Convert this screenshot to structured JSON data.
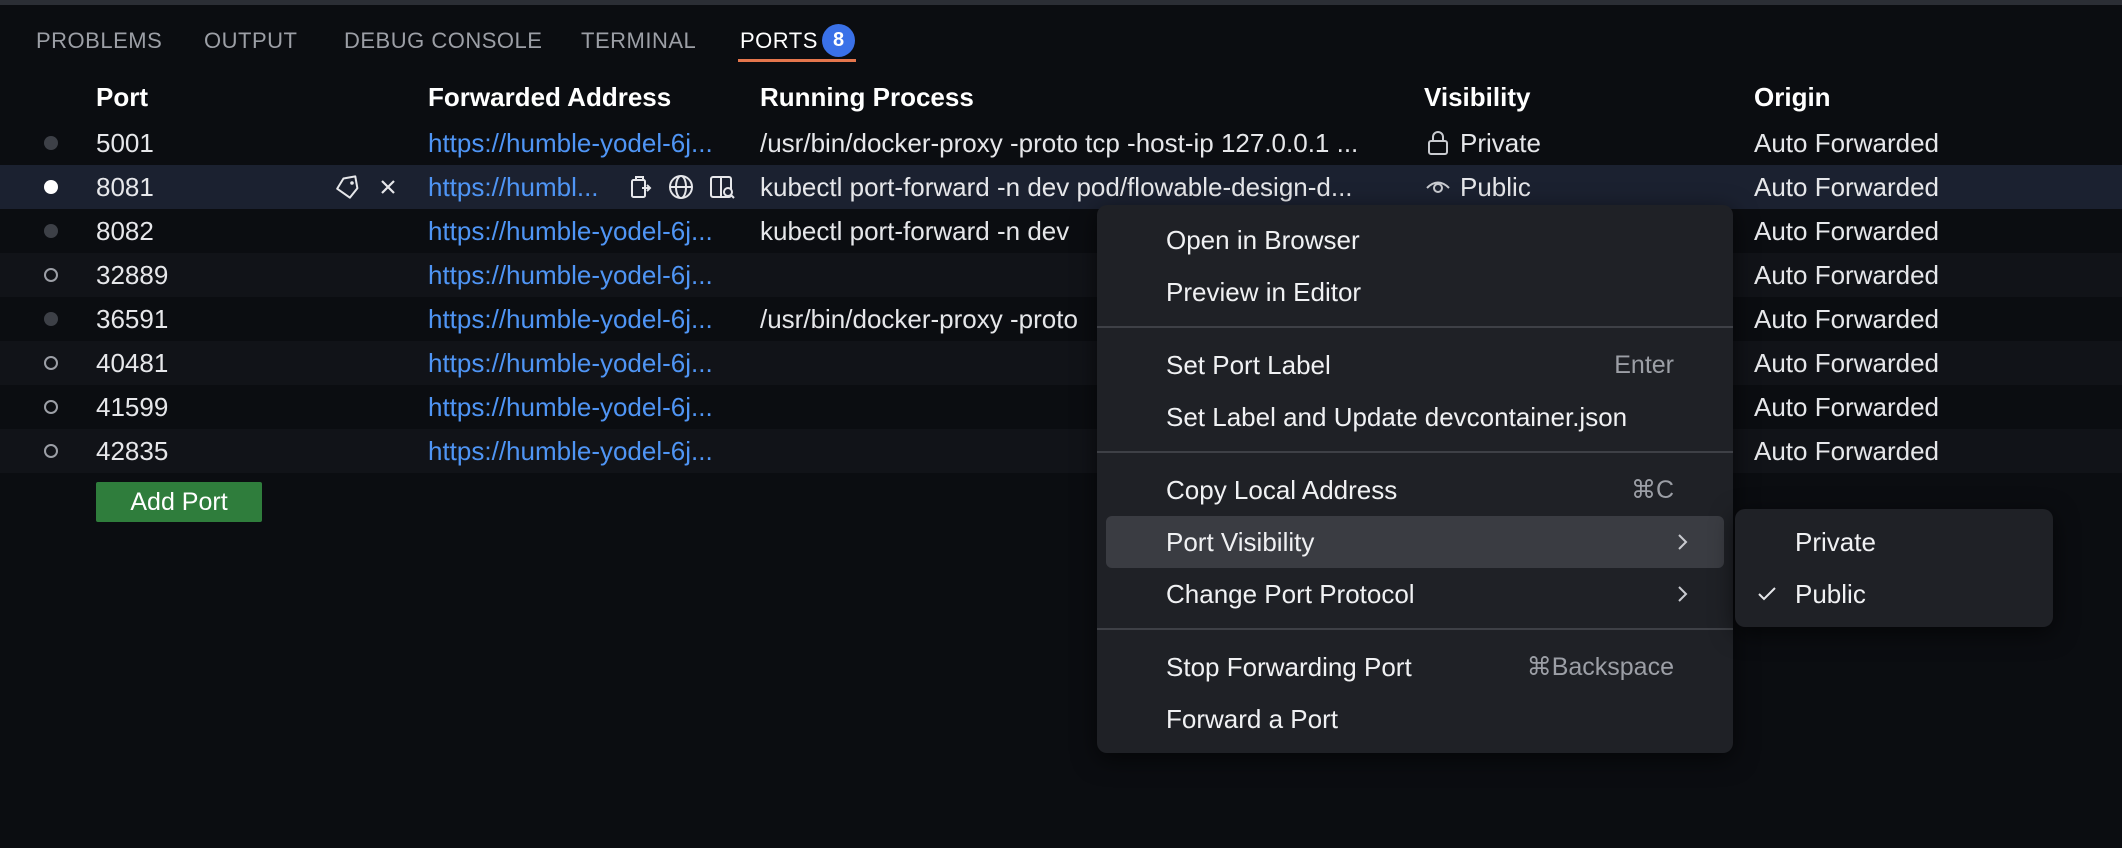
{
  "panel": {
    "tabs": [
      {
        "label": "PROBLEMS"
      },
      {
        "label": "OUTPUT"
      },
      {
        "label": "DEBUG CONSOLE"
      },
      {
        "label": "TERMINAL"
      },
      {
        "label": "PORTS",
        "badge": "8"
      }
    ],
    "active_tab": "PORTS"
  },
  "ports_table": {
    "columns": [
      "Port",
      "Forwarded Address",
      "Running Process",
      "Visibility",
      "Origin"
    ],
    "rows": [
      {
        "status": "inactive",
        "port": "5001",
        "address": "https://humble-yodel-6j...",
        "process": "/usr/bin/docker-proxy -proto tcp -host-ip 127.0.0.1 ...",
        "visibility": "Private",
        "visibility_icon": "lock-icon",
        "origin": "Auto Forwarded"
      },
      {
        "status": "selected",
        "port": "8081",
        "address": "https://humbl...",
        "process": "kubectl port-forward -n dev pod/flowable-design-d...",
        "visibility": "Public",
        "visibility_icon": "eye-icon",
        "origin": "Auto Forwarded"
      },
      {
        "status": "inactive",
        "port": "8082",
        "address": "https://humble-yodel-6j...",
        "process": "kubectl port-forward -n dev",
        "visibility": "",
        "origin": "Auto Forwarded"
      },
      {
        "status": "hollow",
        "port": "32889",
        "address": "https://humble-yodel-6j...",
        "process": "",
        "visibility": "",
        "origin": "Auto Forwarded"
      },
      {
        "status": "inactive",
        "port": "36591",
        "address": "https://humble-yodel-6j...",
        "process": "/usr/bin/docker-proxy -proto",
        "visibility": "",
        "origin": "Auto Forwarded"
      },
      {
        "status": "hollow",
        "port": "40481",
        "address": "https://humble-yodel-6j...",
        "process": "",
        "visibility": "",
        "origin": "Auto Forwarded"
      },
      {
        "status": "hollow",
        "port": "41599",
        "address": "https://humble-yodel-6j...",
        "process": "",
        "visibility": "",
        "origin": "Auto Forwarded"
      },
      {
        "status": "hollow",
        "port": "42835",
        "address": "https://humble-yodel-6j...",
        "process": "",
        "visibility": "",
        "origin": "Auto Forwarded"
      }
    ],
    "row_actions": [
      "tag-icon",
      "close-icon"
    ],
    "address_actions": [
      "copy-icon",
      "globe-icon",
      "preview-icon"
    ],
    "add_port_label": "Add Port"
  },
  "context_menu": {
    "items": [
      {
        "label": "Open in Browser",
        "shortcut": ""
      },
      {
        "label": "Preview in Editor",
        "shortcut": ""
      },
      {
        "label": "Set Port Label",
        "shortcut": "Enter"
      },
      {
        "label": "Set Label and Update devcontainer.json",
        "shortcut": ""
      },
      {
        "label": "Copy Local Address",
        "shortcut": "⌘C"
      },
      {
        "label": "Port Visibility",
        "submenu": true,
        "highlighted": true
      },
      {
        "label": "Change Port Protocol",
        "submenu": true
      },
      {
        "label": "Stop Forwarding Port",
        "shortcut": "⌘Backspace"
      },
      {
        "label": "Forward a Port",
        "shortcut": ""
      }
    ]
  },
  "visibility_submenu": {
    "items": [
      {
        "label": "Private",
        "checked": false
      },
      {
        "label": "Public",
        "checked": true
      }
    ]
  },
  "colors": {
    "background": "#0b0d11",
    "link": "#4f95f5",
    "accent_underline": "#e5764d",
    "badge": "#3a71e8",
    "add_button": "#2f7d3c",
    "menu_bg": "#1f2126"
  }
}
